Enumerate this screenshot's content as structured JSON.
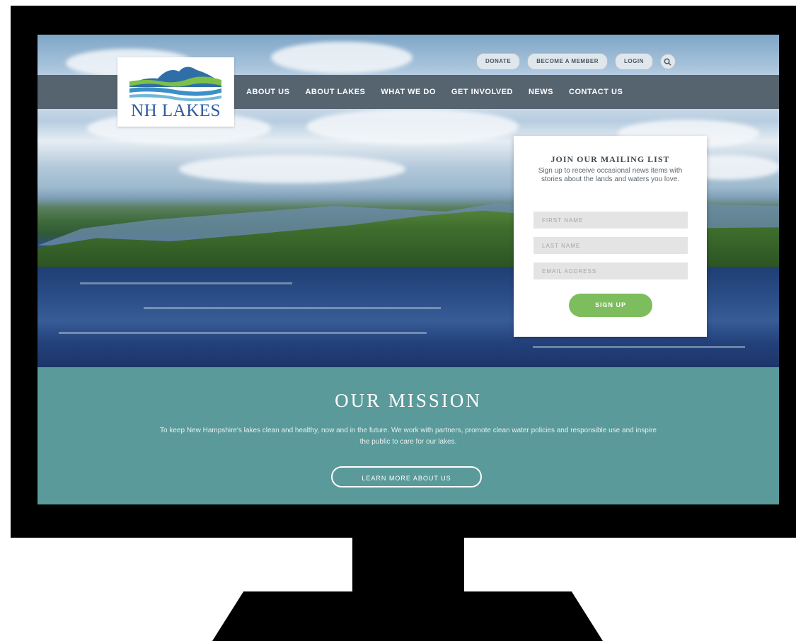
{
  "utility": {
    "buttons": [
      "DONATE",
      "BECOME A MEMBER",
      "LOGIN"
    ],
    "search_icon": "search-icon"
  },
  "logo": {
    "text": "NH LAKES"
  },
  "nav": {
    "items": [
      "ABOUT US",
      "ABOUT LAKES",
      "WHAT WE DO",
      "GET INVOLVED",
      "NEWS",
      "CONTACT US"
    ]
  },
  "signup": {
    "title": "JOIN OUR MAILING LIST",
    "description": "Sign up to receive occasional news items with stories about the lands and waters you love.",
    "first_name_placeholder": "FIRST NAME",
    "last_name_placeholder": "LAST NAME",
    "email_placeholder": "EMAIL ADDRESS",
    "button": "SIGN UP"
  },
  "mission": {
    "title": "OUR MISSION",
    "text": "To keep New Hampshire's lakes clean and healthy, now and in the future. We work with partners, promote clean water policies and responsible use and inspire the public to care for our lakes.",
    "button": "LEARN MORE ABOUT US"
  },
  "colors": {
    "nav_bg": "#566470",
    "mission_bg": "#5a9a9a",
    "signup_button": "#7dbd5d",
    "logo_text": "#2b5aa0"
  }
}
